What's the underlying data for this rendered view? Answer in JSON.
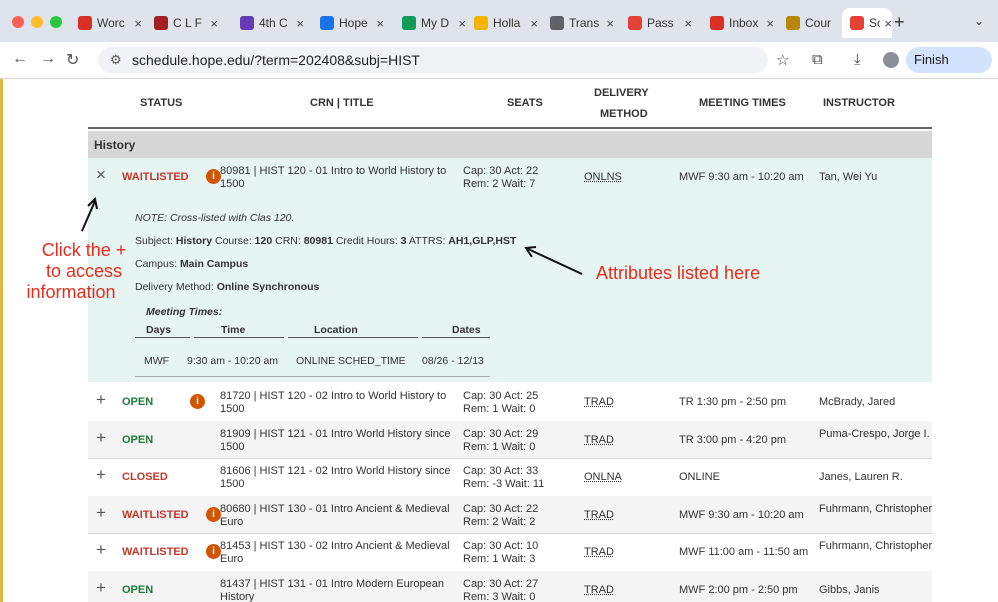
{
  "browser": {
    "tabs": [
      {
        "label": "Worc",
        "icon": "gmail-icon",
        "color": "#d93025"
      },
      {
        "label": "C L F",
        "icon": "college-icon",
        "color": "#a32020"
      },
      {
        "label": "4th C",
        "icon": "forms-icon",
        "color": "#673ab7"
      },
      {
        "label": "Hope",
        "icon": "calendar-icon",
        "color": "#1a73e8"
      },
      {
        "label": "My D",
        "icon": "drive-icon",
        "color": "#0f9d58"
      },
      {
        "label": "Holla",
        "icon": "slides-icon",
        "color": "#f4b400"
      },
      {
        "label": "Trans",
        "icon": "globe-icon",
        "color": "#5f6368"
      },
      {
        "label": "Pass",
        "icon": "acrobat-icon",
        "color": "#e34234"
      },
      {
        "label": "Inbox",
        "icon": "gmail-icon",
        "color": "#d93025"
      },
      {
        "label": "Cour",
        "icon": "college-icon",
        "color": "#b8860b"
      },
      {
        "label": "Sche",
        "icon": "acrobat-icon",
        "color": "#e34234",
        "active": true
      }
    ],
    "url": "schedule.hope.edu/?term=202408&subj=HIST",
    "finish_update": "Finish update"
  },
  "table": {
    "headers": {
      "status": "STATUS",
      "crn_title": "CRN | TITLE",
      "seats": "SEATS",
      "delivery": "DELIVERY",
      "delivery2": "METHOD",
      "meeting": "MEETING TIMES",
      "instructor": "INSTRUCTOR"
    },
    "group": "History",
    "expanded_row": {
      "toggle": "×",
      "status": "WAITLISTED",
      "title": "80981 | HIST 120 - 01 Intro to World History to 1500",
      "seats1": "Cap: 30 Act: 22",
      "seats2": "Rem: 2 Wait: 7",
      "delivery": "ONLNS",
      "meeting": "MWF 9:30 am - 10:20 am",
      "instructor": "Tan, Wei Yu",
      "note": "NOTE: Cross-listed with Clas 120.",
      "subject_label": "Subject:",
      "subject": "History",
      "course_label": "Course:",
      "course": "120",
      "crn_label": "CRN:",
      "crn": "80981",
      "credits_label": "Credit Hours:",
      "credits": "3",
      "attrs_label": "ATTRS:",
      "attrs": "AH1,GLP,HST",
      "campus_label": "Campus:",
      "campus": "Main Campus",
      "delivery_label": "Delivery Method:",
      "delivery_method": "Online Synchronous",
      "meeting_times_label": "Meeting Times:",
      "mt_headers": [
        "Days",
        "Time",
        "Location",
        "Dates"
      ],
      "mt_row": [
        "MWF",
        "9:30 am - 10:20 am",
        "ONLINE SCHED_TIME",
        "08/26 - 12/13"
      ]
    },
    "rows": [
      {
        "toggle": "+",
        "status": "OPEN",
        "kind": "open",
        "info": true,
        "title": "81720 | HIST 120 - 02 Intro to World History to 1500",
        "seats1": "Cap: 30 Act: 25",
        "seats2": "Rem: 1 Wait: 0",
        "delivery": "TRAD",
        "meeting": "TR 1:30 pm - 2:50 pm",
        "instructor": "McBrady, Jared"
      },
      {
        "toggle": "+",
        "status": "OPEN",
        "kind": "open",
        "info": false,
        "title": "81909 | HIST 121 - 01 Intro World History since 1500",
        "seats1": "Cap: 30 Act: 29",
        "seats2": "Rem: 1 Wait: 0",
        "delivery": "TRAD",
        "meeting": "TR 3:00 pm - 4:20 pm",
        "instructor": "Puma-Crespo, Jorge I."
      },
      {
        "toggle": "+",
        "status": "CLOSED",
        "kind": "closed",
        "info": false,
        "title": "81606 | HIST 121 - 02 Intro World History since 1500",
        "seats1": "Cap: 30 Act: 33",
        "seats2": "Rem: -3 Wait: 11",
        "delivery": "ONLNA",
        "meeting": "ONLINE",
        "instructor": "Janes, Lauren R."
      },
      {
        "toggle": "+",
        "status": "WAITLISTED",
        "kind": "wait",
        "info": true,
        "title": "80680 | HIST 130 - 01 Intro Ancient & Medieval Euro",
        "seats1": "Cap: 30 Act: 22",
        "seats2": "Rem: 2 Wait: 2",
        "delivery": "TRAD",
        "meeting": "MWF 9:30 am - 10:20 am",
        "instructor": "Fuhrmann, Christopher"
      },
      {
        "toggle": "+",
        "status": "WAITLISTED",
        "kind": "wait",
        "info": true,
        "title": "81453 | HIST 130 - 02 Intro Ancient & Medieval Euro",
        "seats1": "Cap: 30 Act: 10",
        "seats2": "Rem: 1 Wait: 3",
        "delivery": "TRAD",
        "meeting": "MWF 11:00 am - 11:50 am",
        "instructor": "Fuhrmann, Christopher"
      },
      {
        "toggle": "+",
        "status": "OPEN",
        "kind": "open",
        "info": false,
        "title": "81437 | HIST 131 - 01 Intro Modern European History",
        "seats1": "Cap: 30 Act: 27",
        "seats2": "Rem: 3 Wait: 0",
        "delivery": "TRAD",
        "meeting": "MWF 2:00 pm - 2:50 pm",
        "instructor": "Gibbs, Janis"
      }
    ]
  },
  "annotations": {
    "left_line1": "Click the +",
    "left_line2": "to access",
    "left_line3": "information",
    "right": "Attributes listed here",
    "color": "#e52d1c"
  }
}
